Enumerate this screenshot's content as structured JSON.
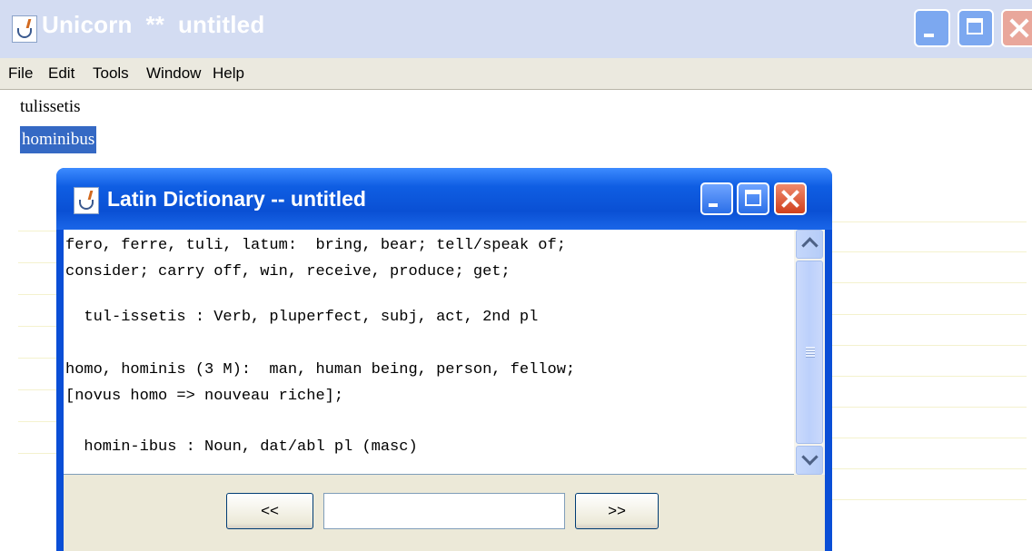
{
  "main_window": {
    "title": "Unicorn  **  untitled",
    "menu": [
      "File",
      "Edit",
      "Tools",
      "Window",
      "Help"
    ],
    "editor_lines": [
      "tulissetis",
      "hominibus"
    ],
    "selected_line_index": 1
  },
  "dialog": {
    "title": "Latin Dictionary -- untitled",
    "output_lines": [
      "fero, ferre, tuli, latum:  bring, bear; tell/speak of;",
      "consider; carry off, win, receive, produce; get;",
      "",
      "  tul-issetis : Verb, pluperfect, subj, act, 2nd pl",
      "",
      "homo, hominis (3 M):  man, human being, person, fellow;",
      "[novus homo => nouveau riche];",
      "",
      "  homin-ibus : Noun, dat/abl pl (masc)"
    ],
    "prev_button": "<<",
    "next_button": ">>",
    "nav_input_value": ""
  },
  "colors": {
    "selection": "#3569c4",
    "dialog_titlebar": "#0a50d4",
    "main_titlebar_inactive": "#d3dcf2"
  },
  "icons": {
    "app_icon": "java-coffee-cup-icon"
  }
}
